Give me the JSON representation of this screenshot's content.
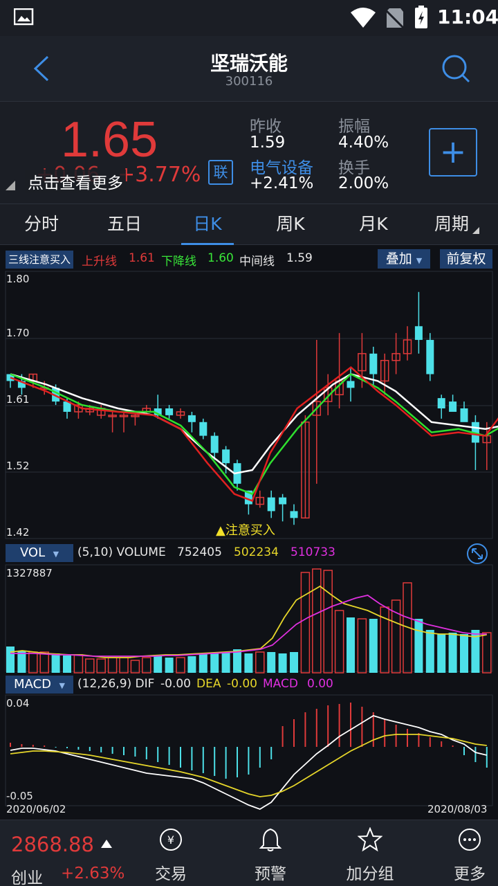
{
  "status_bar": {
    "time": "11:04"
  },
  "header": {
    "title": "坚瑞沃能",
    "code": "300116"
  },
  "quote": {
    "price": "1.65",
    "change": "+0.06",
    "change_pct": "+3.77%",
    "link_badge": "联",
    "tooltip": "点击查看更多",
    "prev_close_label": "昨收",
    "prev_close": "1.59",
    "amplitude_label": "振幅",
    "amplitude": "4.40%",
    "sector_label": "电气设备",
    "sector_change": "+2.41%",
    "turnover_label": "换手",
    "turnover": "2.00%",
    "add_symbol": "+"
  },
  "tabs": [
    {
      "label": "分时"
    },
    {
      "label": "五日"
    },
    {
      "label": "日K"
    },
    {
      "label": "周K"
    },
    {
      "label": "月K"
    },
    {
      "label": "周期"
    }
  ],
  "kline": {
    "indicator": "三线注意买入",
    "up_label": "上升线",
    "up_value": "1.61",
    "down_label": "下降线",
    "down_value": "1.60",
    "mid_label": "中间线",
    "mid_value": "1.59",
    "overlay": "叠加",
    "adjust": "前复权",
    "y_labels": [
      "1.80",
      "1.70",
      "1.61",
      "1.52",
      "1.42"
    ],
    "signal": "▲注意买入"
  },
  "volume": {
    "selector": "VOL",
    "params": "(5,10) VOLUME",
    "volume": "752405",
    "ma5": "502234",
    "ma10": "510733",
    "max": "1327887"
  },
  "macd": {
    "selector": "MACD",
    "params": "(12,26,9) DIF",
    "dif": "-0.00",
    "dea_label": "DEA",
    "dea": "-0.00",
    "macd_label": "MACD",
    "macd": "0.00",
    "top": "0.04",
    "bottom": "-0.05",
    "date_start": "2020/06/02",
    "date_end": "2020/08/03"
  },
  "bottom_nav": {
    "index_value": "2868.88",
    "index_name": "创业",
    "index_change": "+2.63%",
    "items": [
      {
        "label": "交易"
      },
      {
        "label": "预警"
      },
      {
        "label": "加分组"
      },
      {
        "label": "更多"
      }
    ]
  },
  "colors": {
    "up": "#e03a3a",
    "down": "#4de0e8",
    "accent": "#3e8ee6",
    "bg": "#0f1116"
  }
}
